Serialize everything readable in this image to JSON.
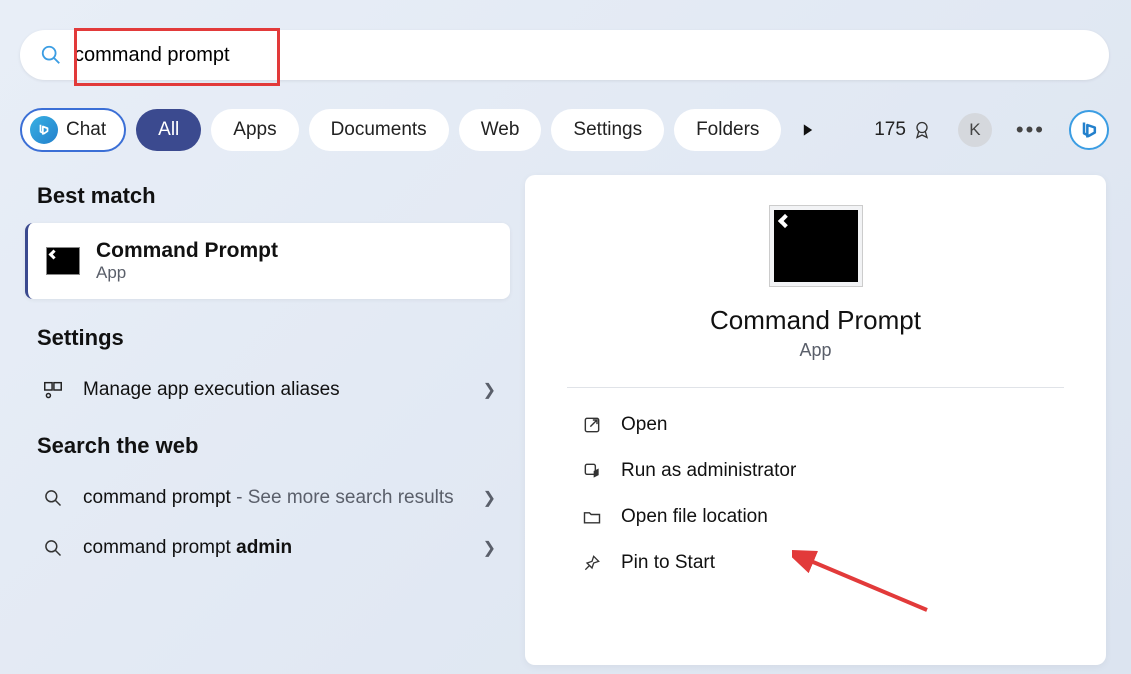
{
  "search": {
    "value": "command prompt"
  },
  "filters": {
    "chat": "Chat",
    "tabs": [
      "All",
      "Apps",
      "Documents",
      "Web",
      "Settings",
      "Folders"
    ],
    "active_index": 0
  },
  "header": {
    "points": "175",
    "avatar_letter": "K"
  },
  "left": {
    "best_match_heading": "Best match",
    "best_match": {
      "title": "Command Prompt",
      "subtitle": "App"
    },
    "settings_heading": "Settings",
    "settings_items": [
      {
        "label": "Manage app execution aliases"
      }
    ],
    "web_heading": "Search the web",
    "web_items": [
      {
        "prefix": "command prompt",
        "suffix": " - See more search results"
      },
      {
        "prefix": "command prompt ",
        "bold": "admin",
        "suffix": ""
      }
    ]
  },
  "panel": {
    "title": "Command Prompt",
    "subtitle": "App",
    "actions": [
      {
        "key": "open",
        "label": "Open"
      },
      {
        "key": "run-admin",
        "label": "Run as administrator"
      },
      {
        "key": "open-loc",
        "label": "Open file location"
      },
      {
        "key": "pin-start",
        "label": "Pin to Start"
      }
    ]
  }
}
